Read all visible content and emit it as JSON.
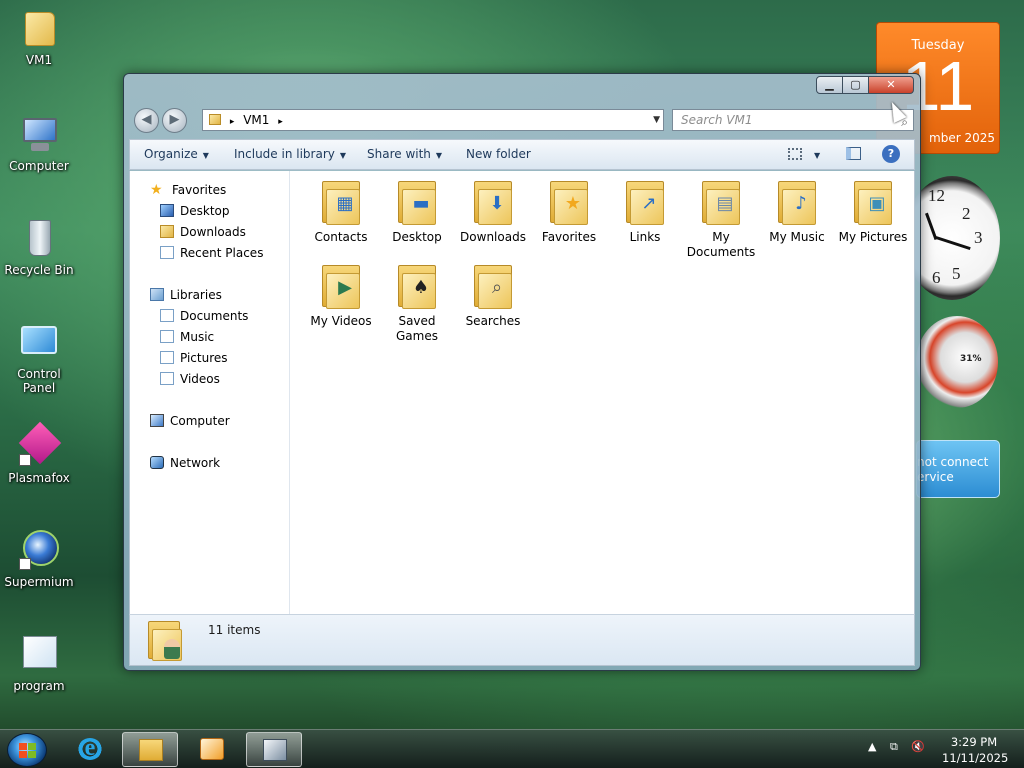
{
  "desktop": {
    "icons": [
      {
        "label": "VM1",
        "icon": "user-folder-icon"
      },
      {
        "label": "Computer",
        "icon": "computer-icon"
      },
      {
        "label": "Recycle Bin",
        "icon": "recycle-bin-icon"
      },
      {
        "label": "Control Panel",
        "icon": "control-panel-icon"
      },
      {
        "label": "Plasmafox",
        "icon": "plasmafox-icon"
      },
      {
        "label": "Supermium",
        "icon": "supermium-icon"
      },
      {
        "label": "program",
        "icon": "program-icon"
      }
    ]
  },
  "gadgets": {
    "calendar": {
      "weekday": "Tuesday",
      "day": "11",
      "month_year": "mber 2025"
    },
    "clock": {
      "numerals": [
        "12",
        "2",
        "3",
        "5",
        "6"
      ]
    },
    "cpu_meter": {
      "percent": "31%"
    },
    "weather": {
      "line1": "not connect",
      "line2": "ervice"
    }
  },
  "window": {
    "controls": {
      "minimize": "▁",
      "maximize": "▢",
      "close": "✕"
    },
    "address": {
      "path": "VM1",
      "separator": "▸"
    },
    "search": {
      "placeholder": "Search VM1"
    },
    "toolbar": {
      "organize": "Organize",
      "include_in_library": "Include in library",
      "share_with": "Share with",
      "new_folder": "New folder"
    },
    "nav_pane": {
      "favorites": {
        "label": "Favorites",
        "items": [
          "Desktop",
          "Downloads",
          "Recent Places"
        ]
      },
      "libraries": {
        "label": "Libraries",
        "items": [
          "Documents",
          "Music",
          "Pictures",
          "Videos"
        ]
      },
      "computer": "Computer",
      "network": "Network"
    },
    "items": [
      {
        "line1": "Contacts",
        "line2": "",
        "icon": "contacts-folder-icon",
        "mark": "▦"
      },
      {
        "line1": "Desktop",
        "line2": "",
        "icon": "desktop-folder-icon",
        "mark": "▬"
      },
      {
        "line1": "Downloads",
        "line2": "",
        "icon": "downloads-folder-icon",
        "mark": "⬇"
      },
      {
        "line1": "Favorites",
        "line2": "",
        "icon": "favorites-folder-icon",
        "mark": "★"
      },
      {
        "line1": "Links",
        "line2": "",
        "icon": "links-folder-icon",
        "mark": "↗"
      },
      {
        "line1": "My",
        "line2": "Documents",
        "icon": "documents-folder-icon",
        "mark": "▤"
      },
      {
        "line1": "My Music",
        "line2": "",
        "icon": "music-folder-icon",
        "mark": "♪"
      },
      {
        "line1": "My Pictures",
        "line2": "",
        "icon": "pictures-folder-icon",
        "mark": "▣"
      },
      {
        "line1": "My Videos",
        "line2": "",
        "icon": "videos-folder-icon",
        "mark": "▶"
      },
      {
        "line1": "Saved",
        "line2": "Games",
        "icon": "saved-games-folder-icon",
        "mark": "♠"
      },
      {
        "line1": "Searches",
        "line2": "",
        "icon": "searches-folder-icon",
        "mark": "⌕"
      }
    ],
    "status": {
      "count": "11 items"
    }
  },
  "taskbar": {
    "apps": [
      {
        "name": "internet-explorer-icon",
        "active": false
      },
      {
        "name": "file-explorer-icon",
        "active": true
      },
      {
        "name": "media-player-icon",
        "active": false
      },
      {
        "name": "remote-desktop-icon",
        "active": false
      }
    ],
    "tray": {
      "expand": "▲",
      "network": "⧉",
      "volume": "🔇"
    },
    "clock": {
      "time": "3:29 PM",
      "date": "11/11/2025"
    }
  }
}
